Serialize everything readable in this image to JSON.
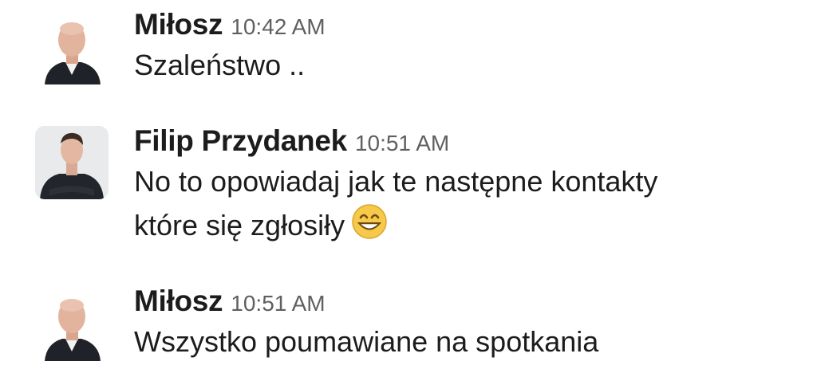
{
  "messages": [
    {
      "sender": "Miłosz",
      "time": "10:42 AM",
      "lines": [
        "Szaleństwo .."
      ],
      "avatar": "milosz-avatar"
    },
    {
      "sender": "Filip Przydanek",
      "time": "10:51 AM",
      "lines": [
        "No to opowiadaj jak te następne kontakty",
        "które się zgłosiły"
      ],
      "emoji": "grinning-face-with-smiling-eyes-icon",
      "avatar": "filip-avatar"
    },
    {
      "sender": "Miłosz",
      "time": "10:51 AM",
      "lines": [
        "Wszystko poumawiane na spotkania"
      ],
      "avatar": "milosz-avatar"
    }
  ]
}
